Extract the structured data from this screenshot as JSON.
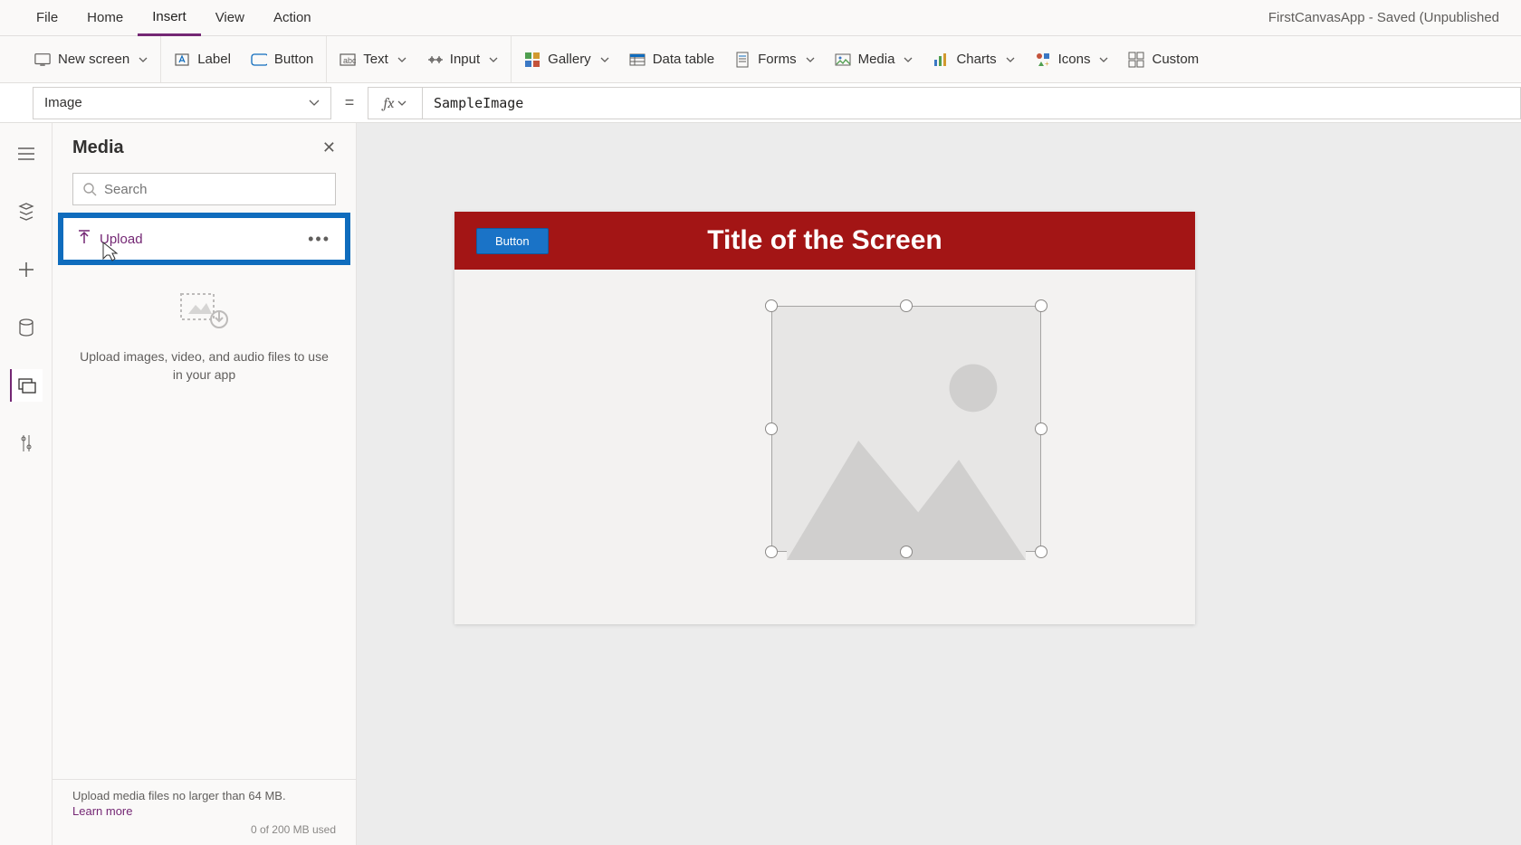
{
  "apptitle": "FirstCanvasApp - Saved (Unpublished",
  "tabs": {
    "file": "File",
    "home": "Home",
    "insert": "Insert",
    "view": "View",
    "action": "Action"
  },
  "active_tab": "insert",
  "ribbon": {
    "new_screen": "New screen",
    "label": "Label",
    "button": "Button",
    "text": "Text",
    "input": "Input",
    "gallery": "Gallery",
    "data_table": "Data table",
    "forms": "Forms",
    "media": "Media",
    "charts": "Charts",
    "icons": "Icons",
    "custom": "Custom"
  },
  "formula": {
    "property": "Image",
    "value": "SampleImage"
  },
  "media_panel": {
    "title": "Media",
    "search_placeholder": "Search",
    "upload_label": "Upload",
    "empty_text": "Upload images, video, and audio files to use in your app",
    "footer_text": "Upload media files no larger than 64 MB.",
    "learn_more": "Learn more",
    "usage": "0 of 200 MB used"
  },
  "canvas": {
    "header_button": "Button",
    "header_title": "Title of the Screen"
  }
}
